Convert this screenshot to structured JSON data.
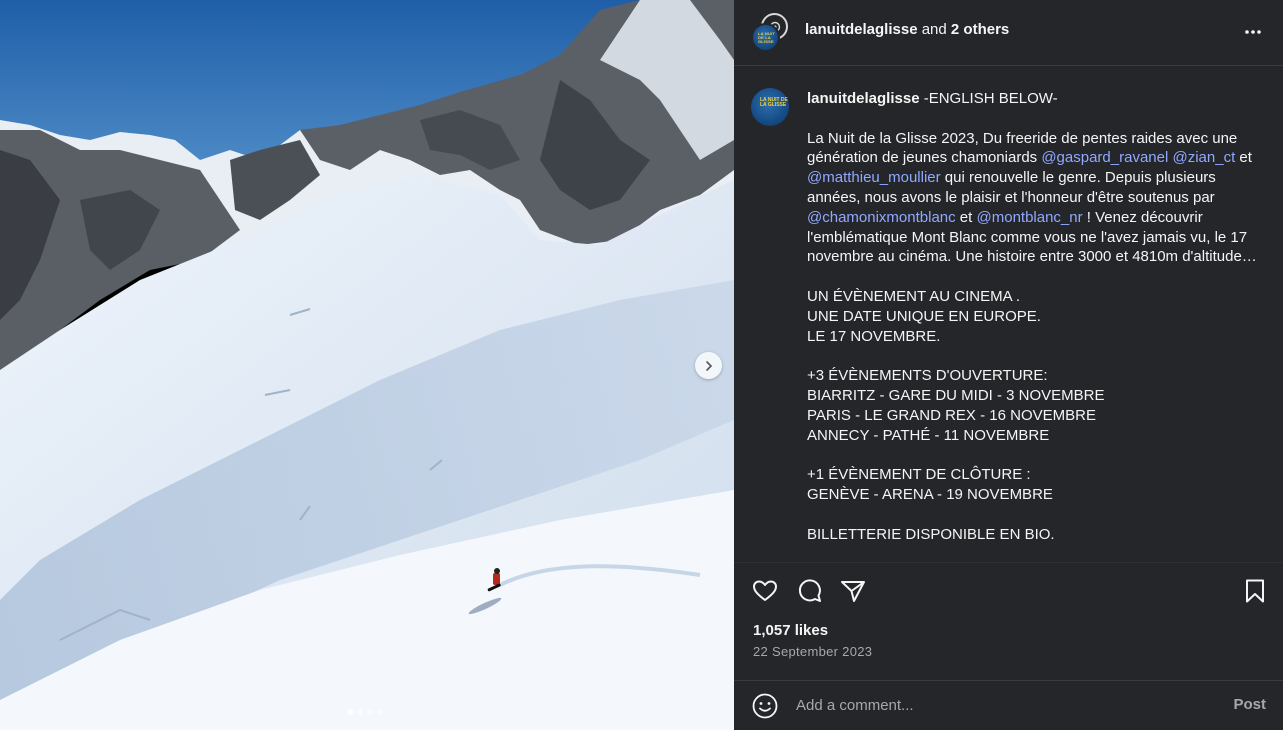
{
  "post": {
    "media": {
      "image_alt": "Snowboarder riding down a snowy mountain slope",
      "slide_count": 4,
      "active_slide": 1
    },
    "header": {
      "username": "lanuitdelaglisse",
      "connector": "and",
      "others": "2 others",
      "avatar_text": "LA NUIT DE LA GLISSE"
    },
    "caption": {
      "username": "lanuitdelaglisse",
      "lead": " -ENGLISH BELOW-",
      "p1_a": "La Nuit de la Glisse 2023, Du freeride de pentes raides avec une génération de jeunes chamoniards ",
      "m1": "@gaspard_ravanel",
      "sp1": " ",
      "m2": "@zian_ct",
      "p1_b": " et ",
      "m3": "@matthieu_moullier",
      "p1_c": " qui renouvelle le genre. Depuis plusieurs années, nous avons le plaisir et l'honneur d'être soutenus par ",
      "m4": "@chamonixmontblanc",
      "p1_d": " et ",
      "m5": "@montblanc_nr",
      "p1_e": " ! Venez découvrir l'emblématique Mont Blanc comme vous ne l'avez jamais vu, le 17 novembre au cinéma. Une histoire entre 3000 et 4810m d'altitude…",
      "b1": [
        "UN ÉVÈNEMENT AU CINEMA .",
        "UNE DATE UNIQUE EN EUROPE.",
        "LE 17 NOVEMBRE."
      ],
      "b2": [
        "+3 ÉVÈNEMENTS D'OUVERTURE:",
        "BIARRITZ - GARE DU MIDI - 3 NOVEMBRE",
        "PARIS - LE GRAND REX - 16 NOVEMBRE",
        "ANNECY - PATHÉ - 11 NOVEMBRE"
      ],
      "b3": [
        "+1 ÉVÈNEMENT DE CLÔTURE :",
        "GENÈVE - ARENA - 19 NOVEMBRE"
      ],
      "b4": [
        "BILLETTERIE DISPONIBLE EN BIO."
      ]
    },
    "likes": "1,057 likes",
    "date": "22 September 2023",
    "comment": {
      "placeholder": "Add a comment...",
      "post_label": "Post"
    },
    "icons": {
      "more": "more-horizontal-icon",
      "like": "heart-icon",
      "comment": "comment-bubble-icon",
      "share": "paper-plane-icon",
      "save": "bookmark-icon",
      "emoji": "emoji-icon",
      "next": "chevron-right-icon"
    }
  }
}
